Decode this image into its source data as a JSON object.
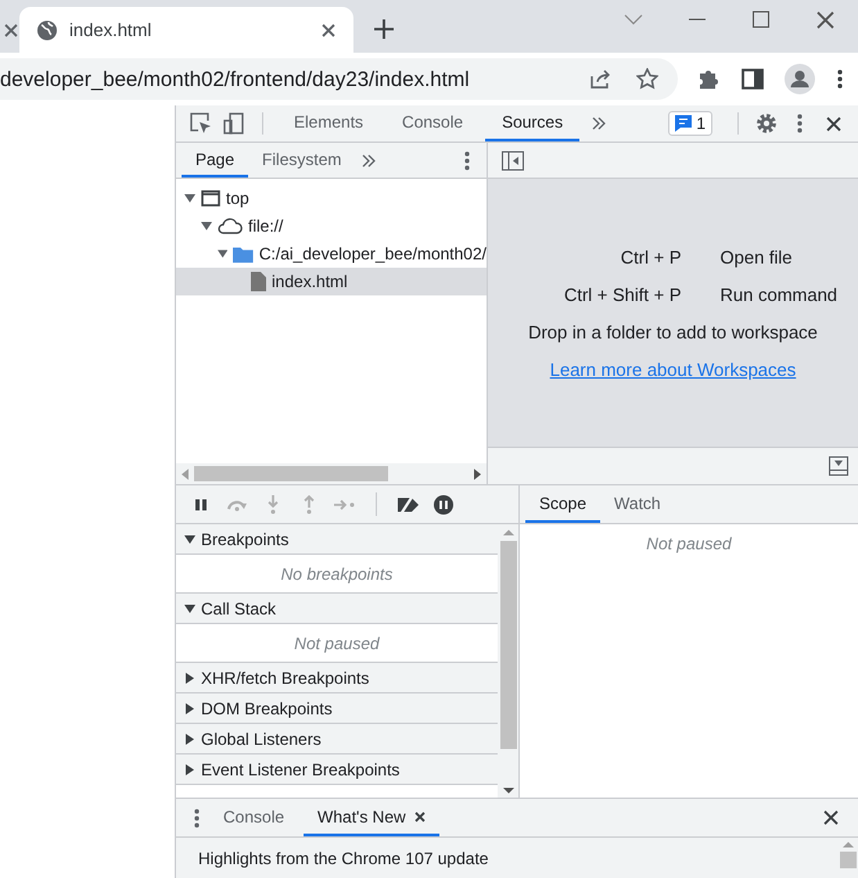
{
  "tab_strip": {
    "tabs": [
      {
        "selected": false
      },
      {
        "title": "index.html",
        "selected": true
      }
    ]
  },
  "address_bar": {
    "url": "developer_bee/month02/frontend/day23/index.html"
  },
  "devtools": {
    "panel_tabs": [
      {
        "label": "Elements",
        "selected": false
      },
      {
        "label": "Console",
        "selected": false
      },
      {
        "label": "Sources",
        "selected": true
      }
    ],
    "issues_badge": "1",
    "navigator": {
      "tabs": [
        {
          "label": "Page",
          "selected": true
        },
        {
          "label": "Filesystem",
          "selected": false
        }
      ],
      "tree": [
        {
          "label": "top",
          "kind": "frame",
          "expanded": true,
          "selected": false,
          "children": [
            {
              "label": "file://",
              "kind": "origin",
              "expanded": true,
              "selected": false,
              "children": [
                {
                  "label": "C:/ai_developer_bee/month02/",
                  "kind": "folder",
                  "expanded": true,
                  "selected": false,
                  "children": [
                    {
                      "label": "index.html",
                      "kind": "file",
                      "selected": true
                    }
                  ]
                }
              ]
            }
          ]
        }
      ]
    },
    "shortcuts": [
      {
        "keys": "Ctrl + P",
        "action": "Open file"
      },
      {
        "keys": "Ctrl + Shift + P",
        "action": "Run command"
      }
    ],
    "drop_hint": "Drop in a folder to add to workspace",
    "workspace_link": "Learn more about Workspaces",
    "debugger_sections": [
      {
        "title": "Breakpoints",
        "expanded": true,
        "message": "No breakpoints"
      },
      {
        "title": "Call Stack",
        "expanded": true,
        "message": "Not paused"
      },
      {
        "title": "XHR/fetch Breakpoints",
        "expanded": false
      },
      {
        "title": "DOM Breakpoints",
        "expanded": false
      },
      {
        "title": "Global Listeners",
        "expanded": false
      },
      {
        "title": "Event Listener Breakpoints",
        "expanded": false
      }
    ],
    "sidebar_tabs": [
      {
        "label": "Scope",
        "selected": true
      },
      {
        "label": "Watch",
        "selected": false
      }
    ],
    "scope_message": "Not paused",
    "drawer": {
      "tabs": [
        {
          "label": "Console",
          "selected": false,
          "closable": false
        },
        {
          "label": "What's New",
          "selected": true,
          "closable": true
        }
      ],
      "content": "Highlights from the Chrome 107 update"
    }
  }
}
